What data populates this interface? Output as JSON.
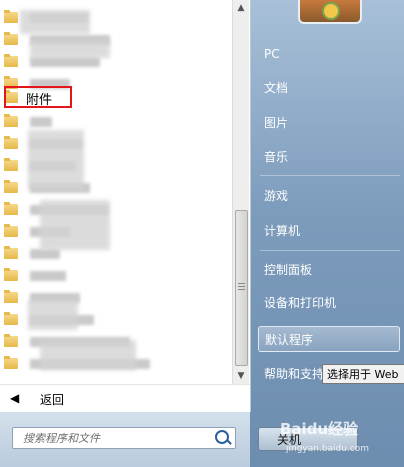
{
  "left_pane": {
    "highlighted_folder": "附件",
    "back_label": "返回",
    "search_placeholder": "搜索程序和文件"
  },
  "right_pane": {
    "items": [
      "PC",
      "文档",
      "图片",
      "音乐",
      "游戏",
      "计算机",
      "控制面板",
      "设备和打印机",
      "默认程序",
      "帮助和支持"
    ],
    "highlighted_item": "默认程序",
    "tooltip": "选择用于 Web",
    "shutdown_label": "关机"
  },
  "watermark": {
    "main": "Baidu经验",
    "sub": "jingyan.baidu.com"
  }
}
